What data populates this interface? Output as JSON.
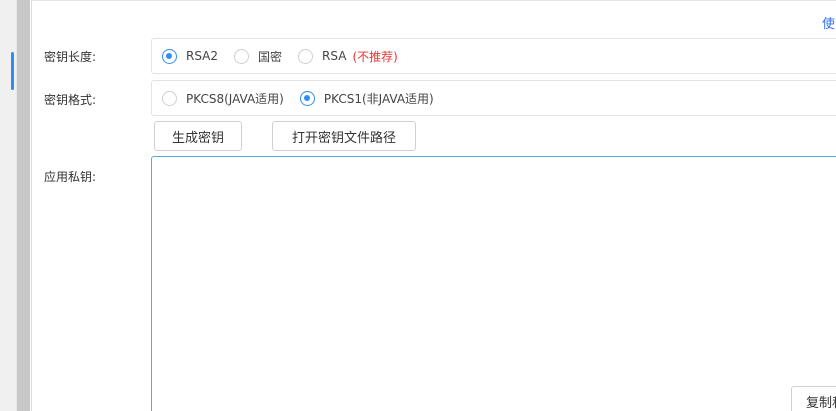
{
  "usage_link": "使",
  "key_length": {
    "label": "密钥长度:",
    "options": [
      {
        "label": "RSA2",
        "checked": true
      },
      {
        "label": "国密",
        "checked": false
      },
      {
        "label": "RSA",
        "checked": false,
        "note": "(不推荐)"
      }
    ]
  },
  "key_format": {
    "label": "密钥格式:",
    "options": [
      {
        "label": "PKCS8(JAVA适用)",
        "checked": false
      },
      {
        "label": "PKCS1(非JAVA适用)",
        "checked": true
      }
    ]
  },
  "buttons": {
    "generate": "生成密钥",
    "open_path": "打开密钥文件路径"
  },
  "private_key": {
    "label": "应用私钥:",
    "value": "",
    "copy_label": "复制私"
  },
  "colors": {
    "accent": "#2f8ff0",
    "warning": "#e53935",
    "link": "#2f6ff0"
  }
}
